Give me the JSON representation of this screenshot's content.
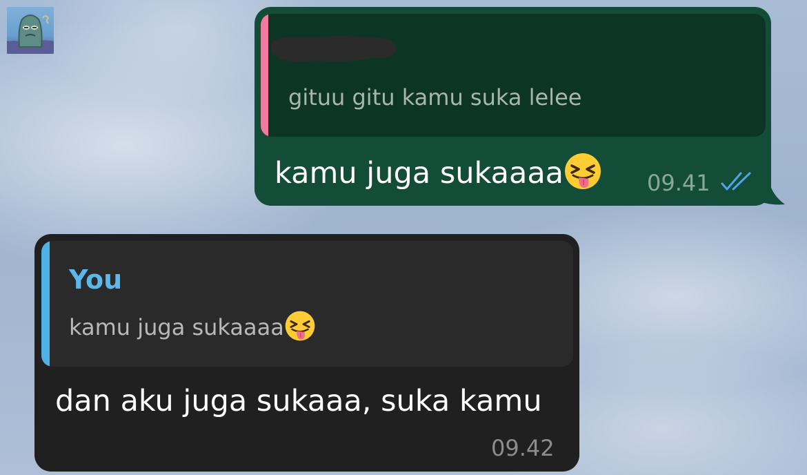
{
  "chat": {
    "avatar_icon": "contact-avatar-icon",
    "outgoing": {
      "quote": {
        "sender_redacted": true,
        "text": "gituu gitu kamu suka lelee",
        "accent_color": "#f07aa1"
      },
      "text": "kamu juga sukaaaa",
      "emoji": "😝",
      "time": "09.41",
      "status_icon": "double-check-read-icon",
      "bubble_color": "#144d37"
    },
    "incoming": {
      "quote": {
        "sender": "You",
        "text": "kamu juga sukaaaa",
        "emoji": "😝",
        "accent_color": "#4fb2e4"
      },
      "text": "dan aku juga sukaaa, suka kamu",
      "time": "09.42",
      "bubble_color": "#202020"
    }
  }
}
